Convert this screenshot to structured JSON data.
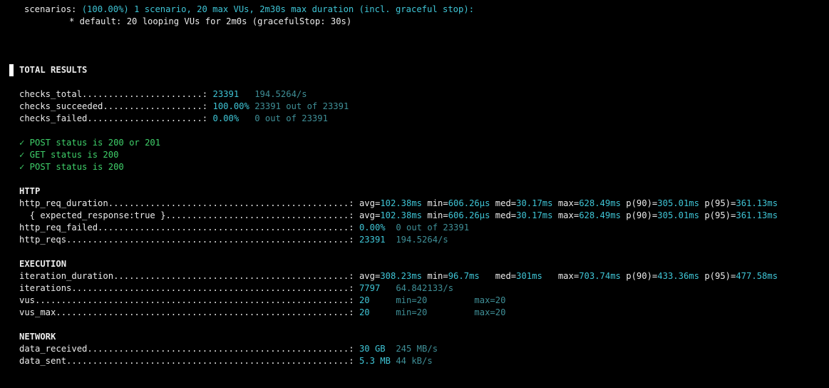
{
  "header": {
    "scenarios_label": "scenarios:",
    "scenarios_value": "(100.00%) 1 scenario, 20 max VUs, 2m30s max duration (incl. graceful stop):",
    "default_line": "* default: 20 looping VUs for 2m0s (gracefulStop: 30s)"
  },
  "total_results": "TOTAL RESULTS",
  "checks": [
    {
      "label": "checks_total.......................:",
      "value": "23391",
      "extra": "194.5264/s",
      "gap": "   "
    },
    {
      "label": "checks_succeeded...................:",
      "value": "100.00%",
      "extra": "23391 out of 23391",
      "gap": " "
    },
    {
      "label": "checks_failed......................:",
      "value": "0.00%",
      "extra": "0 out of 23391",
      "gap": "   "
    }
  ],
  "check_results": [
    "✓ POST status is 200 or 201",
    "✓ GET status is 200",
    "✓ POST status is 200"
  ],
  "sections": {
    "http": "HTTP",
    "execution": "EXECUTION",
    "network": "NETWORK"
  },
  "http": {
    "req_duration": {
      "label": "http_req_duration..............................................:",
      "avg": "102.38ms",
      "min": "606.26µs",
      "med": "30.17ms",
      "max": "628.49ms",
      "p90": "305.01ms",
      "p95": "361.13ms"
    },
    "expected": {
      "label": "  { expected_response:true }...................................:",
      "avg": "102.38ms",
      "min": "606.26µs",
      "med": "30.17ms",
      "max": "628.49ms",
      "p90": "305.01ms",
      "p95": "361.13ms"
    },
    "req_failed": {
      "label": "http_req_failed................................................:",
      "value": "0.00%",
      "extra": "0 out of 23391"
    },
    "reqs": {
      "label": "http_reqs......................................................:",
      "value": "23391",
      "extra": "194.5264/s"
    }
  },
  "execution": {
    "iteration_duration": {
      "label": "iteration_duration.............................................:",
      "avg": "308.23ms",
      "min": "96.7ms",
      "med": "301ms",
      "max": "703.74ms",
      "p90": "433.36ms",
      "p95": "477.58ms"
    },
    "iterations": {
      "label": "iterations.....................................................:",
      "value": "7797",
      "extra": "64.842133/s"
    },
    "vus": {
      "label": "vus............................................................:",
      "value": "20",
      "min": "min=20",
      "max": "max=20"
    },
    "vus_max": {
      "label": "vus_max........................................................:",
      "value": "20",
      "min": "min=20",
      "max": "max=20"
    }
  },
  "network": {
    "data_received": {
      "label": "data_received..................................................:",
      "value": "30 GB",
      "extra": "245 MB/s"
    },
    "data_sent": {
      "label": "data_sent......................................................:",
      "value": "5.3 MB",
      "extra": "44 kB/s"
    }
  },
  "keys": {
    "avg": "avg=",
    "min": "min=",
    "med": "med=",
    "max": "max=",
    "p90": "p(90)=",
    "p95": "p(95)="
  },
  "colors": {
    "background": "#000000",
    "accent": "#3fc5d6",
    "dim": "#3f8f97",
    "success": "#3fd06a"
  }
}
